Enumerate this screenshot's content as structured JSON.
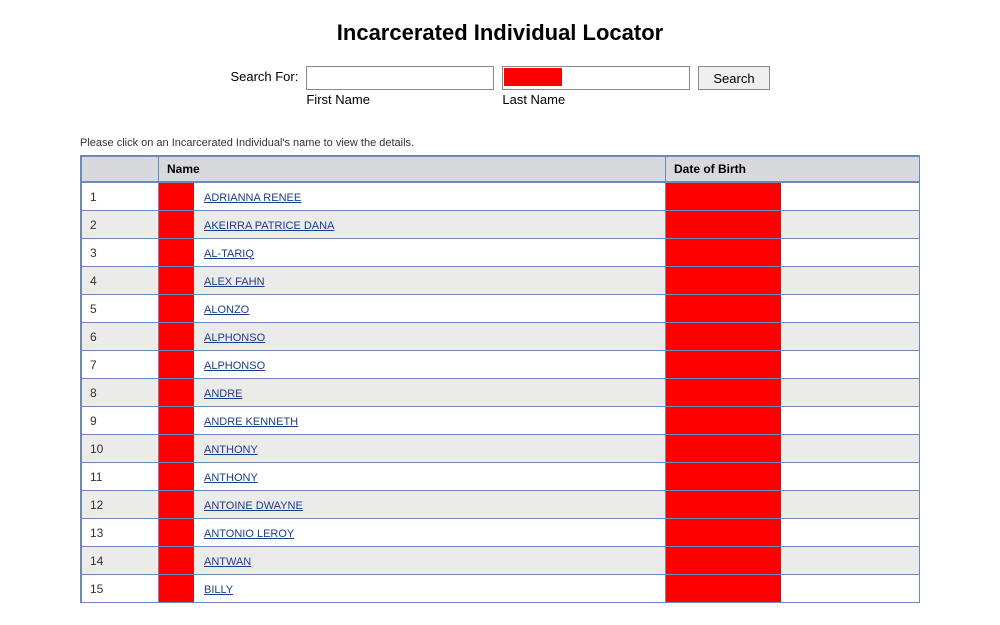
{
  "title": "Incarcerated Individual Locator",
  "search": {
    "label": "Search For:",
    "first_name_label": "First Name",
    "last_name_label": "Last Name",
    "button": "Search",
    "first_name_value": "",
    "last_name_value": ""
  },
  "instructions": "Please click on an Incarcerated Individual's name to view the details.",
  "columns": {
    "num": "",
    "name": "Name",
    "dob": "Date of Birth"
  },
  "rows": [
    {
      "num": "1",
      "name": "ADRIANNA RENEE"
    },
    {
      "num": "2",
      "name": "AKEIRRA PATRICE DANA"
    },
    {
      "num": "3",
      "name": "AL-TARIQ"
    },
    {
      "num": "4",
      "name": "ALEX FAHN"
    },
    {
      "num": "5",
      "name": "ALONZO"
    },
    {
      "num": "6",
      "name": "ALPHONSO"
    },
    {
      "num": "7",
      "name": "ALPHONSO"
    },
    {
      "num": "8",
      "name": "ANDRE"
    },
    {
      "num": "9",
      "name": "ANDRE KENNETH"
    },
    {
      "num": "10",
      "name": "ANTHONY"
    },
    {
      "num": "11",
      "name": "ANTHONY"
    },
    {
      "num": "12",
      "name": "ANTOINE DWAYNE"
    },
    {
      "num": "13",
      "name": "ANTONIO LEROY"
    },
    {
      "num": "14",
      "name": "ANTWAN"
    },
    {
      "num": "15",
      "name": "BILLY"
    }
  ]
}
